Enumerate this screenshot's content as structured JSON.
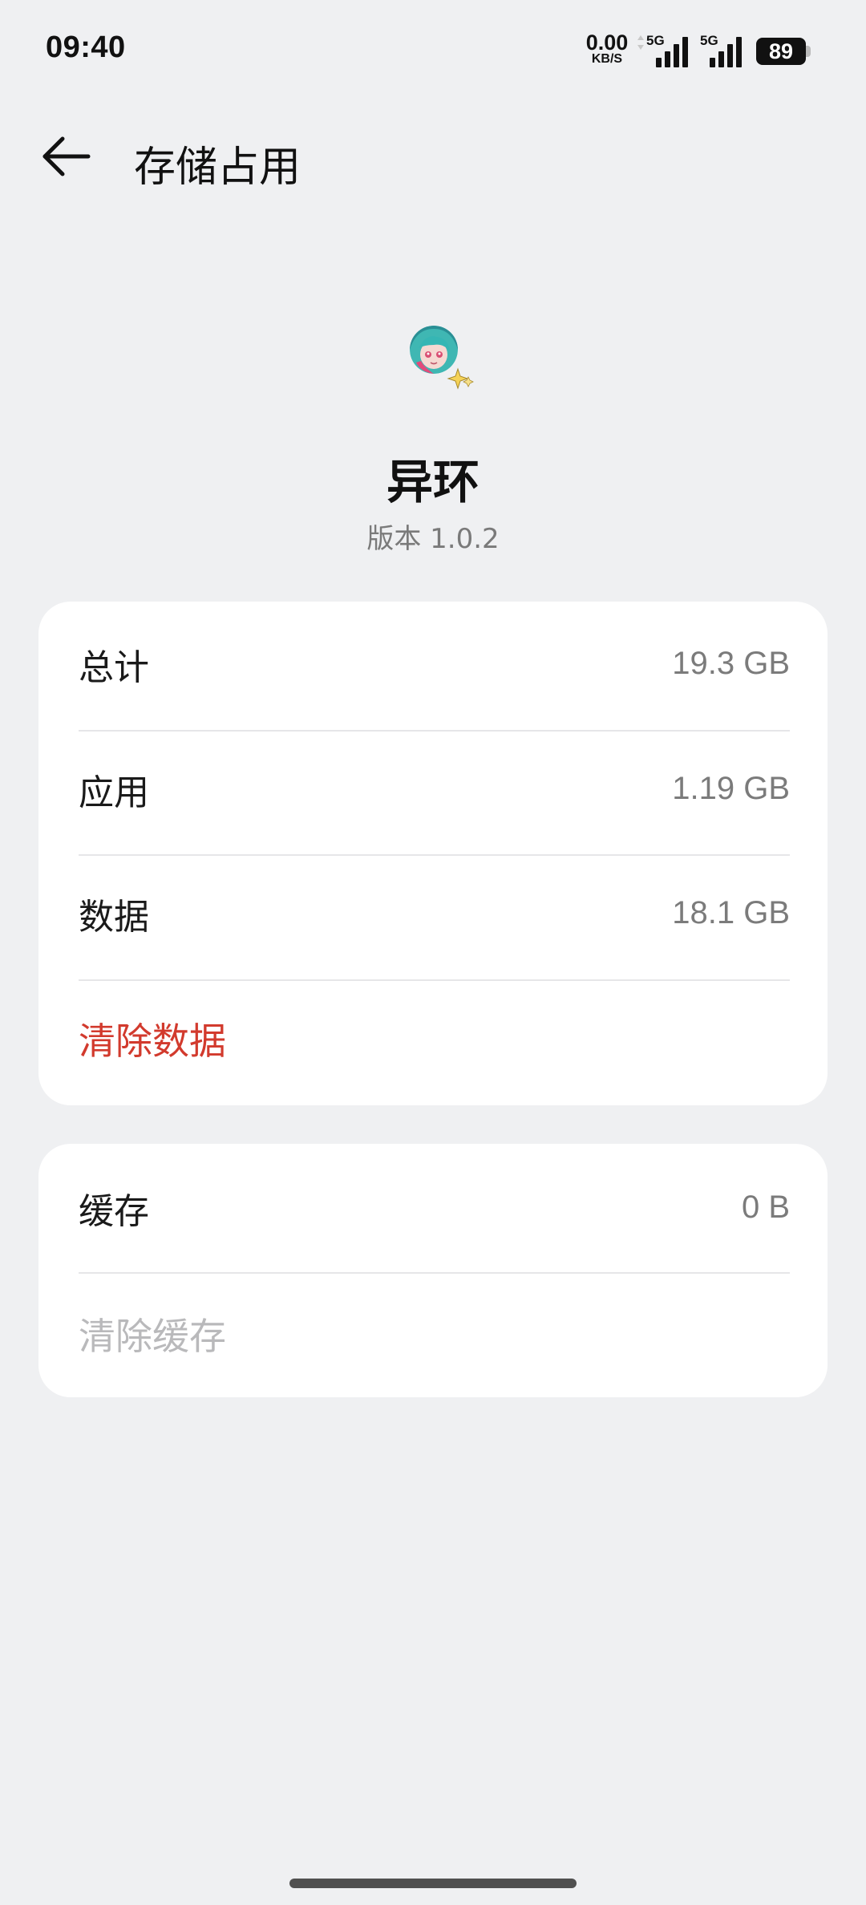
{
  "status_bar": {
    "time": "09:40",
    "net_speed_value": "0.00",
    "net_speed_unit": "KB/S",
    "signal_1_label": "5G",
    "signal_2_label": "5G",
    "battery_level": "89"
  },
  "header": {
    "back_icon": "arrow-left-icon",
    "title": "存储占用"
  },
  "app": {
    "name": "异环",
    "version": "版本  1.0.2"
  },
  "storage": {
    "rows": [
      {
        "label": "总计",
        "value": "19.3 GB"
      },
      {
        "label": "应用",
        "value": "1.19 GB"
      },
      {
        "label": "数据",
        "value": "18.1 GB"
      }
    ],
    "clear_data_label": "清除数据"
  },
  "cache": {
    "label": "缓存",
    "value": "0 B",
    "clear_cache_label": "清除缓存"
  },
  "colors": {
    "background": "#eff0f2",
    "card": "#ffffff",
    "danger": "#d23a2d",
    "disabled": "#b9b9bb",
    "secondary_text": "#7b7b7b"
  }
}
